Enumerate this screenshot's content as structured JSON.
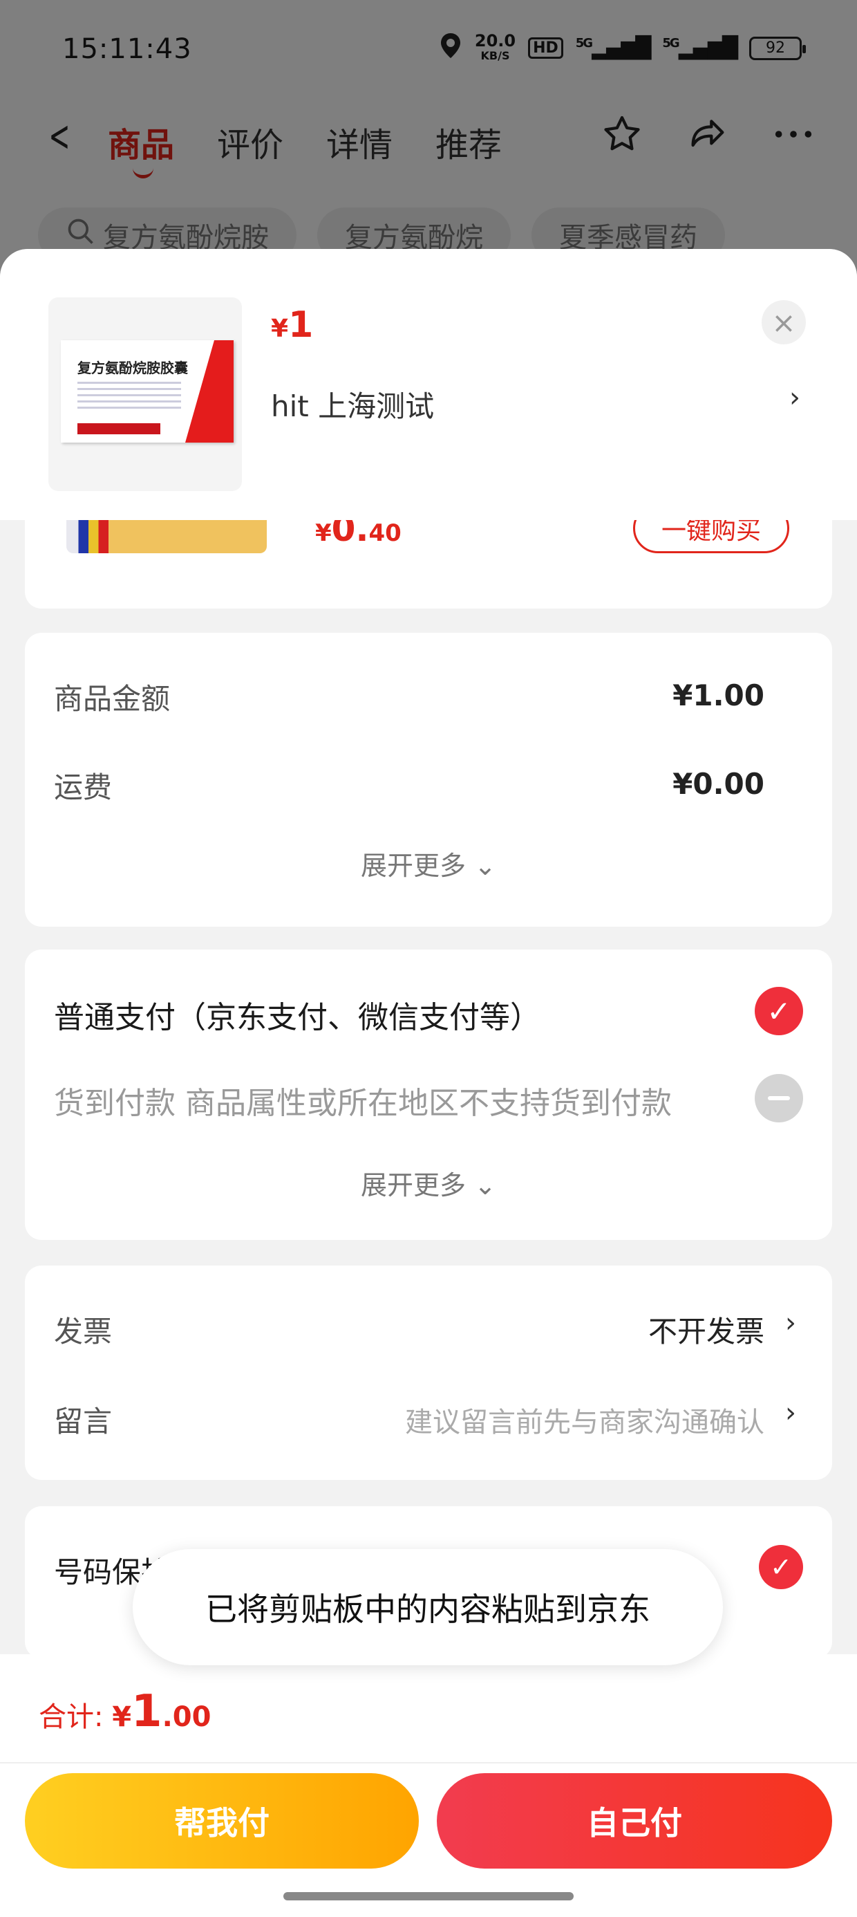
{
  "status_bar": {
    "time": "15:11:43",
    "net_speed": "20.0",
    "net_unit": "KB/S",
    "hd": "HD",
    "sig1": "5G",
    "sig2": "5G",
    "battery": "92",
    "icons": [
      "location-icon",
      "hd-icon",
      "signal-icon",
      "signal-icon",
      "battery-icon"
    ]
  },
  "nav": {
    "tabs": [
      "商品",
      "评价",
      "详情",
      "推荐"
    ],
    "active_tab": 0,
    "icons": [
      "back-icon",
      "star-icon",
      "share-icon",
      "more-icon"
    ]
  },
  "search_chips": [
    "复方氨酚烷胺",
    "复方氨酚烷",
    "夏季感冒药"
  ],
  "product": {
    "box_name": "复方氨酚烷胺胶囊",
    "currency": "¥",
    "price": "1",
    "shop": "hit  上海测试"
  },
  "partial_item": {
    "currency": "¥",
    "price_int": "0.",
    "price_dec": "40",
    "buy_button": "一键购买"
  },
  "amount": {
    "goods_label": "商品金额",
    "goods_value": "¥1.00",
    "shipping_label": "运费",
    "shipping_value": "¥0.00",
    "expand": "展开更多 ⌄"
  },
  "payment": {
    "option_normal": "普通支付（京东支付、微信支付等）",
    "option_cod": "货到付款 商品属性或所在地区不支持货到付款",
    "expand": "展开更多 ⌄"
  },
  "invoice": {
    "invoice_label": "发票",
    "invoice_value": "不开发票",
    "message_label": "留言",
    "message_hint": "建议留言前先与商家沟通确认"
  },
  "phone": {
    "label": "号码保护"
  },
  "toast": "已将剪贴板中的内容粘贴到京东",
  "bottom": {
    "total_label": "合计: ",
    "currency": "¥",
    "total_int": "1",
    "total_dec": ".00",
    "help_pay": "帮我付",
    "self_pay": "自己付"
  },
  "colors": {
    "accent": "#e1251b",
    "help_button": "#ffb300",
    "self_button": "#f23c3c"
  }
}
